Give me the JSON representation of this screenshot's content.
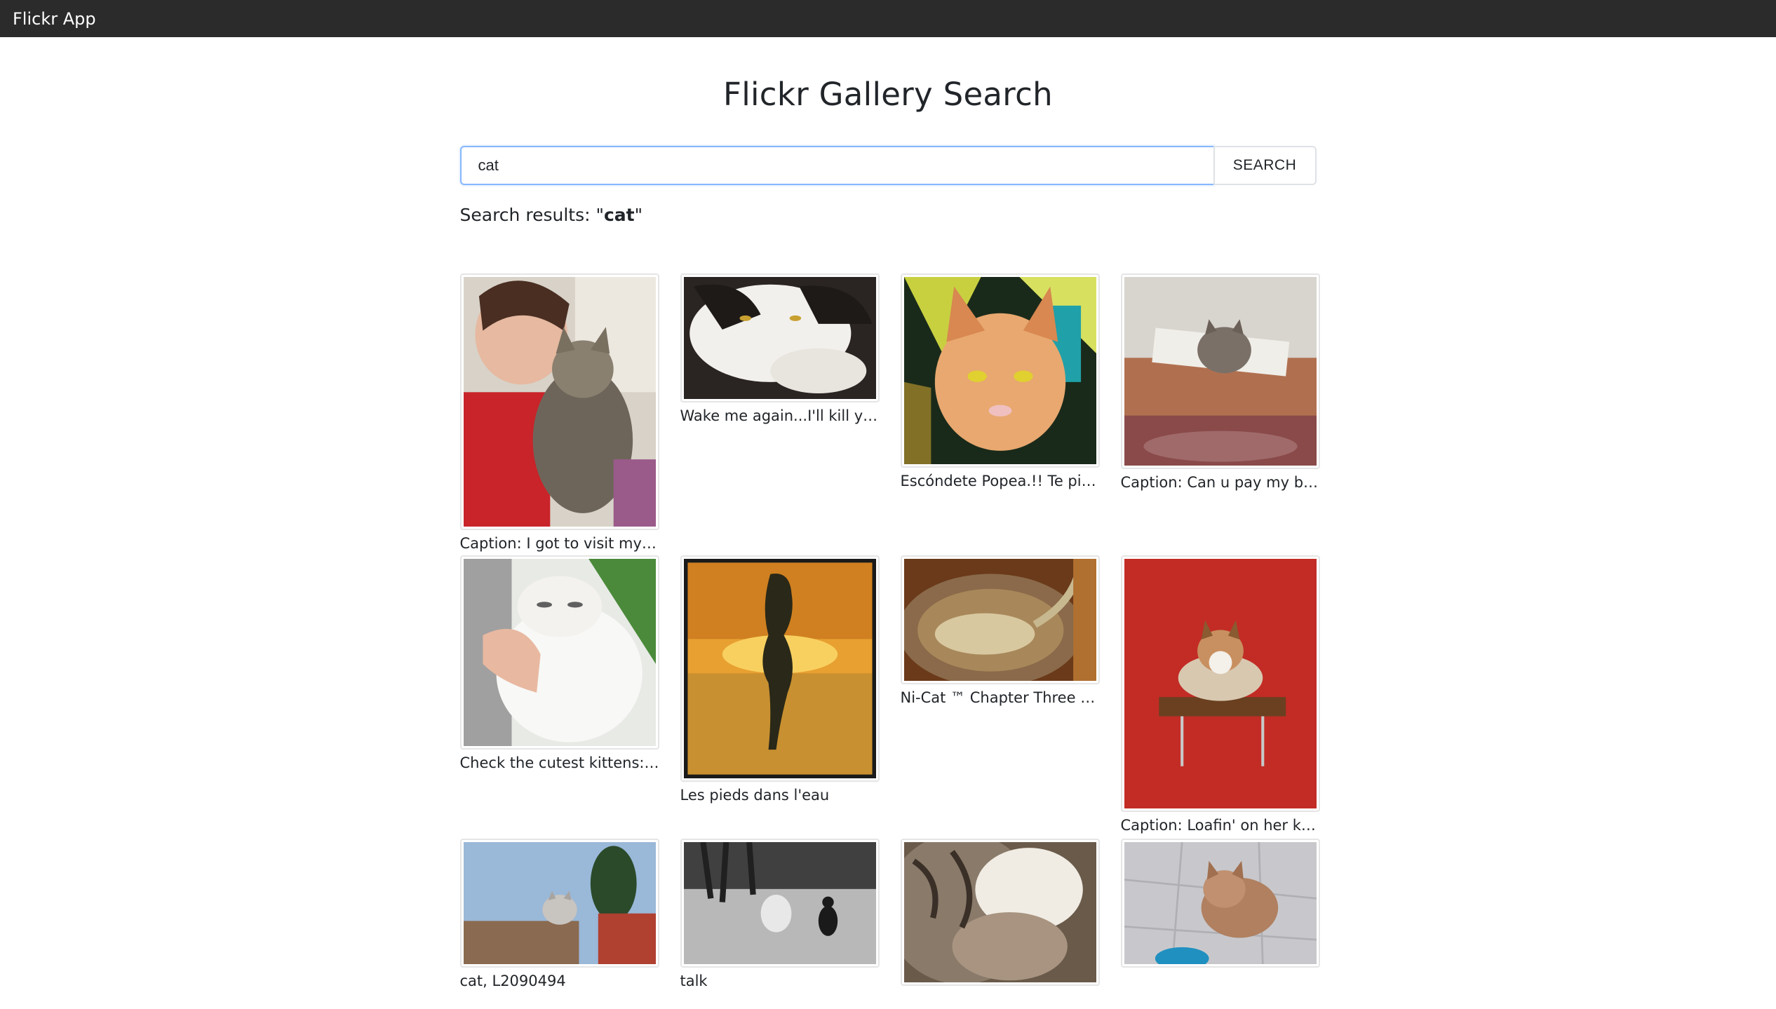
{
  "app": {
    "name": "Flickr App"
  },
  "page": {
    "title": "Flickr Gallery Search",
    "search_value": "cat",
    "search_button_label": "SEARCH",
    "results_prefix": "Search results: \"",
    "results_query": "cat",
    "results_suffix": "\""
  },
  "photos": [
    {
      "caption": "Caption: I got to visit my b..."
    },
    {
      "caption": "Wake me again...I'll kill you!"
    },
    {
      "caption": "Escóndete Popea.!! Te pillé.."
    },
    {
      "caption": "Caption: Can u pay my bill..."
    },
    {
      "caption": "Check the cutest kittens: h..."
    },
    {
      "caption": "Les pieds dans l'eau"
    },
    {
      "caption": "Ni-Cat ™ Chapter Three Of..."
    },
    {
      "caption": "Caption: Loafin' on her kitt.."
    },
    {
      "caption": "cat, L2090494"
    },
    {
      "caption": "talk"
    },
    {
      "caption": ""
    },
    {
      "caption": ""
    }
  ]
}
